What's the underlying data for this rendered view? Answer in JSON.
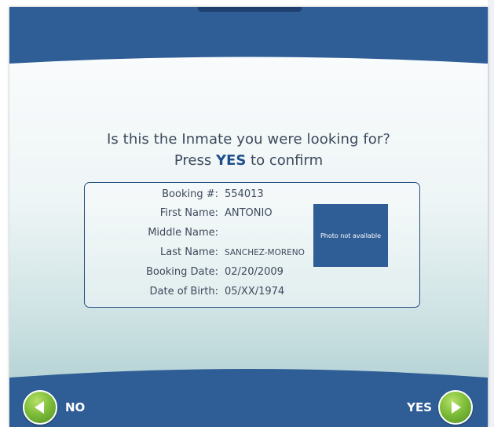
{
  "prompt": {
    "question": "Is this the Inmate you were looking for?",
    "press": "Press",
    "yes_word": "YES",
    "to_confirm": "to confirm"
  },
  "record": {
    "booking_label": "Booking #:",
    "booking_value": "554013",
    "first_label": "First Name:",
    "first_value": "ANTONIO",
    "middle_label": "Middle Name:",
    "middle_value": "",
    "last_label": "Last Name:",
    "last_value": "SANCHEZ-MORENO",
    "date_label": "Booking Date:",
    "date_value": "02/20/2009",
    "dob_label": "Date of Birth:",
    "dob_value": "05/XX/1974",
    "photo_text": "Photo not available"
  },
  "buttons": {
    "no_label": "NO",
    "yes_label": "YES",
    "no_icon": "arrow-left-icon",
    "yes_icon": "arrow-right-icon"
  },
  "colors": {
    "header_blue": "#2f5d96",
    "button_green": "#7fbf3a",
    "accent_text": "#1f4f8a"
  }
}
